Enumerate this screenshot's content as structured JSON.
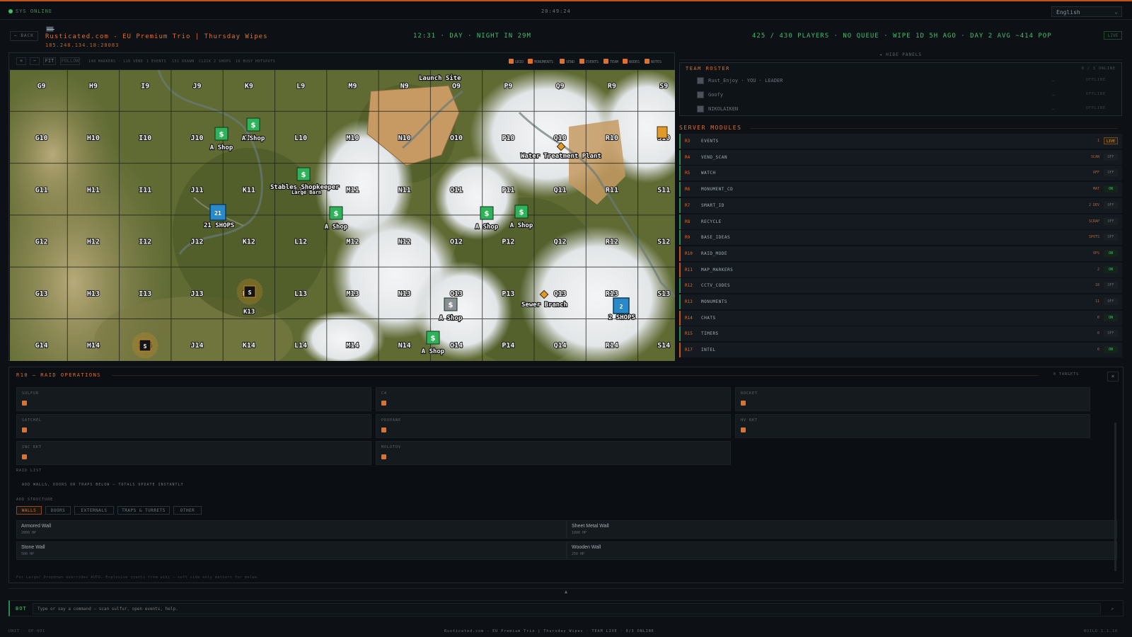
{
  "status": {
    "online": "SYS ONLINE",
    "clock": "20:49:24",
    "language": "English"
  },
  "header": {
    "back": "← BACK",
    "server_name": "Rusticated.com - EU Premium Trio | Thursday Wipes",
    "server_ip": "185.248.134.18:28083",
    "daytime": "12:31 · DAY · NIGHT IN 29M",
    "players": "425 / 430 PLAYERS · NO QUEUE · WIPE 1D 5H AGO · DAY 2 AVG ~414 POP",
    "live": "LIVE"
  },
  "map_toolbar": {
    "zoom_in": "+",
    "zoom_out": "−",
    "fit": "FIT",
    "follow": "FOLLOW",
    "stats": [
      "148 MARKERS · 116 VEND",
      "1 EVENTS",
      "151 DRAWN",
      "CLICK 2 SHOPS",
      "16 BUSY HOTSPOTS"
    ],
    "filters": [
      "GRID",
      "MONUMENTS",
      "VEND",
      "EVENTS",
      "TEAM",
      "NODES",
      "NOTES"
    ]
  },
  "map": {
    "columns": [
      "G",
      "H",
      "I",
      "J",
      "K",
      "L",
      "M",
      "N",
      "O",
      "P",
      "Q",
      "R",
      "S"
    ],
    "rows": [
      "9",
      "10",
      "11",
      "12",
      "13",
      "14"
    ],
    "labels": {
      "launch_site": "Launch Site",
      "water_treatment": "Water Treatment Plant",
      "stables": "Stables Shopkeeper",
      "stables_under": "Large Barn",
      "sewer_branch": "Sewer Branch",
      "shops_21": "21 SHOPS",
      "shops_21_count": "21",
      "shops_2": "2 SHOPS",
      "shops_2_count": "2",
      "a_shop": "A Shop",
      "k13": "K13",
      "shop_glyph": "$",
      "cluster_glyph": "S"
    }
  },
  "panels": {
    "hide": "◂ HIDE PANELS"
  },
  "roster": {
    "title": "TEAM ROSTER",
    "count": "0 / 3 ONLINE",
    "members": [
      {
        "name": "Rust_Enjoy · YOU · LEADER",
        "status": "OFFLINE"
      },
      {
        "name": "Goofy",
        "status": "OFFLINE"
      },
      {
        "name": "NIKOLAIKEN",
        "status": "OFFLINE"
      }
    ]
  },
  "modules": {
    "title": "SERVER MODULES",
    "items": [
      {
        "id": "R3",
        "name": "EVENTS",
        "value": "1",
        "toggle": "LIVE"
      },
      {
        "id": "R4",
        "name": "VEND_SCAN",
        "value": "SCAN",
        "toggle": "OFF"
      },
      {
        "id": "R5",
        "name": "WATCH",
        "value": "OFF",
        "toggle": "OFF"
      },
      {
        "id": "R6",
        "name": "MONUMENT_CD",
        "value": "MAT",
        "toggle": "ON"
      },
      {
        "id": "R7",
        "name": "SMART_ID",
        "value": "2 DEV",
        "toggle": "OFF"
      },
      {
        "id": "R8",
        "name": "RECYCLE",
        "value": "SCRAP",
        "toggle": "OFF"
      },
      {
        "id": "R9",
        "name": "BASE_IDEAS",
        "value": "SPOTS",
        "toggle": "OFF"
      },
      {
        "id": "R10",
        "name": "RAID_MODE",
        "value": "OPS",
        "toggle": "ON"
      },
      {
        "id": "R11",
        "name": "MAP_MARKERS",
        "value": "2",
        "toggle": "ON"
      },
      {
        "id": "R12",
        "name": "CCTV_CODES",
        "value": "18",
        "toggle": "OFF"
      },
      {
        "id": "R13",
        "name": "MONUMENTS",
        "value": "11",
        "toggle": "OFF"
      },
      {
        "id": "R14",
        "name": "CHATS",
        "value": "0",
        "toggle": "ON"
      },
      {
        "id": "R15",
        "name": "TIMERS",
        "value": "0",
        "toggle": "OFF"
      },
      {
        "id": "R17",
        "name": "INTEL",
        "value": "6",
        "toggle": "ON"
      }
    ]
  },
  "raid": {
    "title": "R10 — RAID OPERATIONS",
    "targets": "0 TARGETS",
    "close": "×",
    "explosives": [
      "SULFUR",
      "C4",
      "ROCKET",
      "SATCHEL",
      "PROPANE",
      "HV RKT",
      "INC RKT",
      "MOLOTOV"
    ],
    "raid_list_label": "RAID LIST",
    "raid_list_hint": "ADD WALLS, DOORS OR TRAPS BELOW — TOTALS UPDATE INSTANTLY",
    "add_structure_label": "ADD STRUCTURE",
    "tabs": [
      "WALLS",
      "DOORS",
      "EXTERNALS",
      "TRAPS & TURRETS",
      "OTHER"
    ],
    "walls": [
      {
        "name": "Armored Wall",
        "hp": "2000 HP"
      },
      {
        "name": "Sheet Metal Wall",
        "hp": "1000 HP"
      },
      {
        "name": "Stone Wall",
        "hp": "500 HP"
      },
      {
        "name": "Wooden Wall",
        "hp": "250 HP"
      }
    ],
    "footnote": "For Large/ Dropdown overrides AUTO. Explosive counts from wiki — soft side only matters for melee."
  },
  "bot": {
    "label": "BOT",
    "placeholder": "Type or say a command — scan sulfur, open events, help.",
    "send": "↗",
    "collapse": "▲"
  },
  "footer": {
    "left": "UNIT · OP-001",
    "center": "Rusticated.com - EU Premium Trio | Thursday Wipes · TEAM LIVE · 0/3 ONLINE",
    "right": "BUILD 1.1.10"
  },
  "colors": {
    "accent": "#e0702a",
    "online": "#3fbf6a",
    "shop": "#2fb35a",
    "cluster": "#2a8ac8"
  }
}
